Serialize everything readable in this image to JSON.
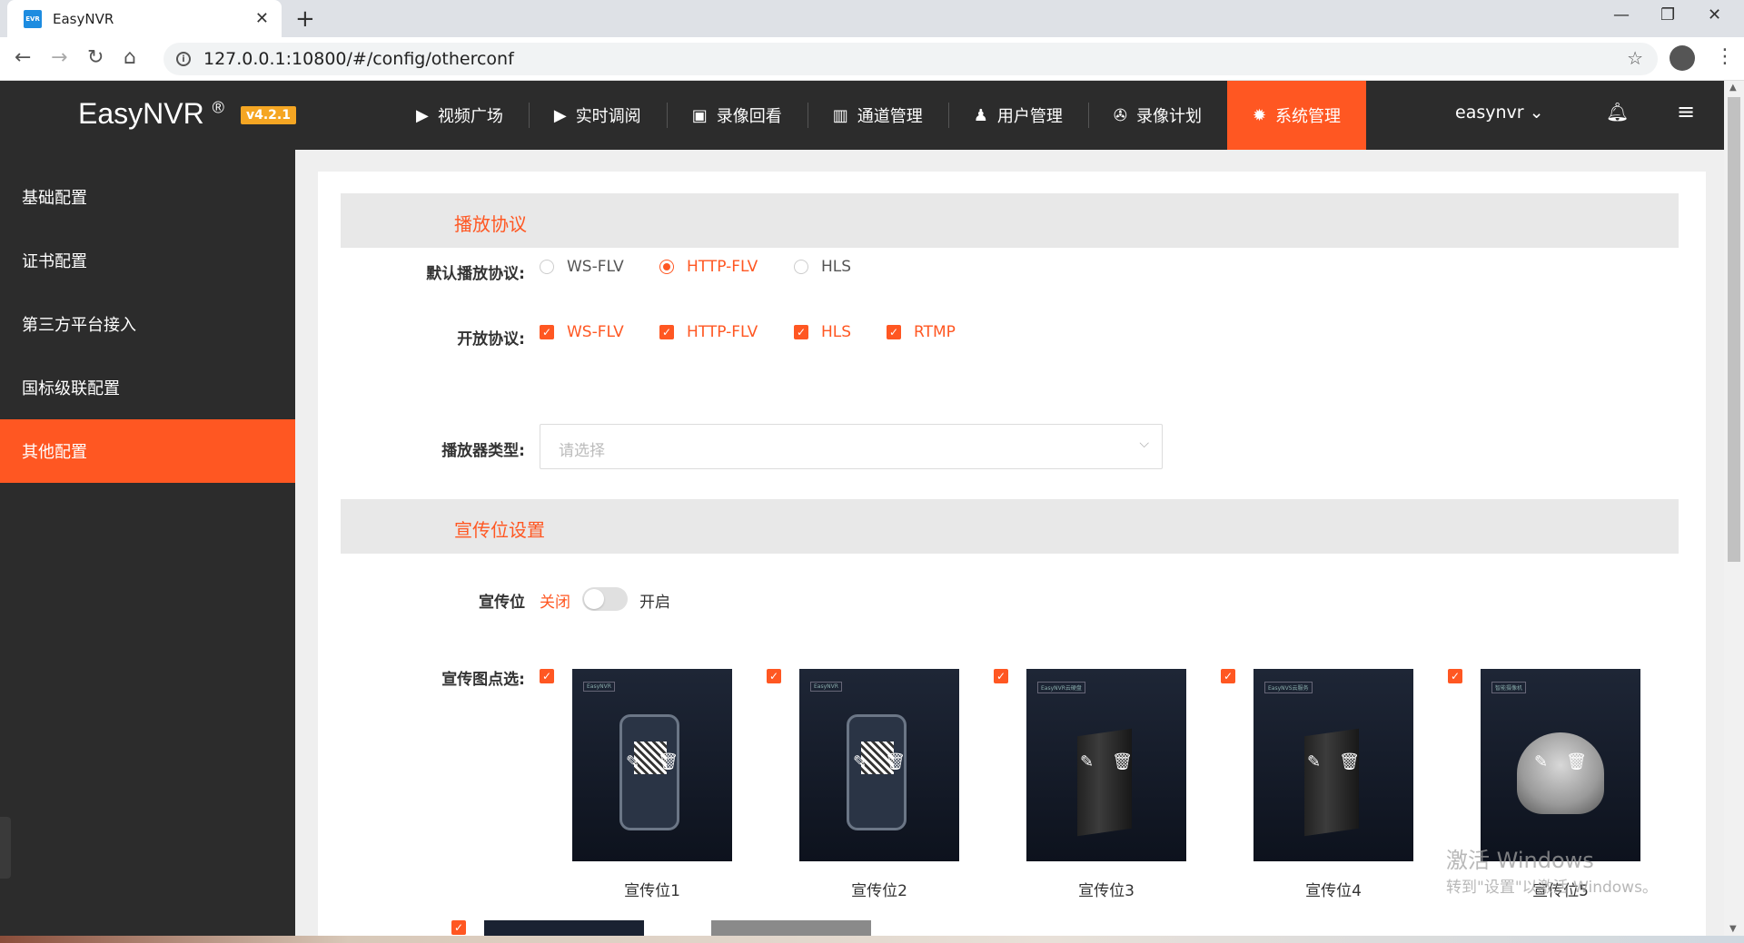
{
  "browser": {
    "tab_title": "EasyNVR",
    "favicon_text": "EVR",
    "url": "127.0.0.1:10800/#/config/otherconf"
  },
  "header": {
    "brand": "EasyNVR",
    "brand_mark": "®",
    "version": "v4.2.1",
    "nav": [
      {
        "label": "视频广场",
        "icon": "play-circle-icon"
      },
      {
        "label": "实时调阅",
        "icon": "video-icon"
      },
      {
        "label": "录像回看",
        "icon": "playback-icon"
      },
      {
        "label": "通道管理",
        "icon": "channels-icon"
      },
      {
        "label": "用户管理",
        "icon": "user-admin-icon"
      },
      {
        "label": "录像计划",
        "icon": "film-reel-icon"
      },
      {
        "label": "系统管理",
        "icon": "gear-icon",
        "active": true
      }
    ],
    "user": "easynvr"
  },
  "sidebar": {
    "items": [
      {
        "label": "基础配置"
      },
      {
        "label": "证书配置"
      },
      {
        "label": "第三方平台接入"
      },
      {
        "label": "国标级联配置"
      },
      {
        "label": "其他配置",
        "active": true
      }
    ]
  },
  "play_section": {
    "title": "播放协议",
    "default_label": "默认播放协议:",
    "default_options": [
      {
        "label": "WS-FLV",
        "selected": false
      },
      {
        "label": "HTTP-FLV",
        "selected": true
      },
      {
        "label": "HLS",
        "selected": false
      }
    ],
    "open_label": "开放协议:",
    "open_options": [
      {
        "label": "WS-FLV",
        "checked": true
      },
      {
        "label": "HTTP-FLV",
        "checked": true
      },
      {
        "label": "HLS",
        "checked": true
      },
      {
        "label": "RTMP",
        "checked": true
      }
    ],
    "player_label": "播放器类型:",
    "player_placeholder": "请选择"
  },
  "promo_section": {
    "title": "宣传位设置",
    "switch_label": "宣传位",
    "switch_off": "关闭",
    "switch_on": "开启",
    "switch_state": false,
    "pick_label": "宣传图点选:",
    "items": [
      {
        "caption": "宣传位1",
        "checked": true,
        "tag": "EasyNVR"
      },
      {
        "caption": "宣传位2",
        "checked": true,
        "tag": "EasyNVR"
      },
      {
        "caption": "宣传位3",
        "checked": true,
        "tag": "EasyNVR云硬盘"
      },
      {
        "caption": "宣传位4",
        "checked": true,
        "tag": "EasyNVS云服务"
      },
      {
        "caption": "宣传位5",
        "checked": true,
        "tag": "智能摄像机"
      }
    ]
  },
  "watermark": {
    "line1": "激活 Windows",
    "line2": "转到\"设置\"以激活 Windows。"
  },
  "colors": {
    "accent": "#ff5722",
    "header_bg": "#2c2c2c",
    "version_badge": "#f5a623"
  }
}
